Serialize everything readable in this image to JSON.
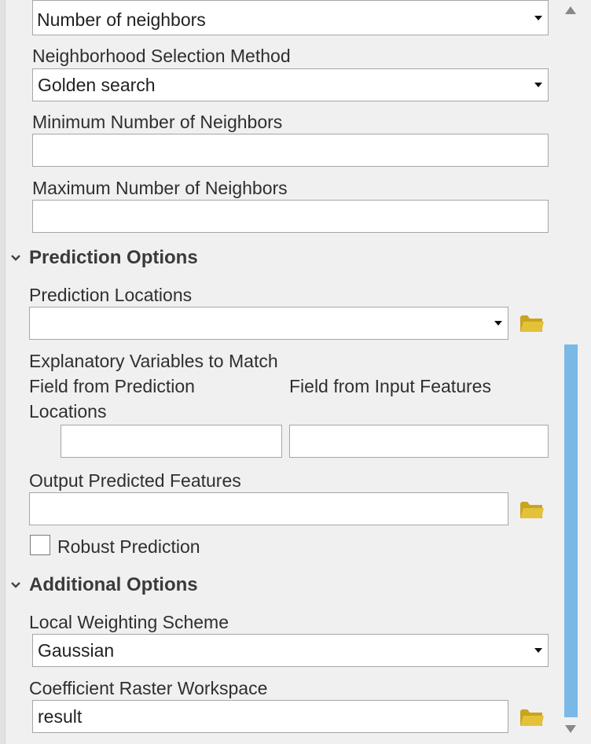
{
  "neighbors_section": {
    "type_value": "Number of neighbors",
    "selection_method_label": "Neighborhood Selection Method",
    "selection_method_value": "Golden search",
    "min_neighbors_label": "Minimum Number of Neighbors",
    "min_neighbors_value": "",
    "max_neighbors_label": "Maximum Number of Neighbors",
    "max_neighbors_value": ""
  },
  "prediction_options": {
    "title": "Prediction Options",
    "locations_label": "Prediction Locations",
    "locations_value": "",
    "explanatory_label": "Explanatory Variables to Match",
    "col_prediction_line1": "Field from Prediction",
    "col_prediction_line2": "Locations",
    "col_input": "Field from Input Features",
    "field_prediction_value": "",
    "field_input_value": "",
    "output_label": "Output Predicted Features",
    "output_value": "",
    "robust_label": "Robust Prediction",
    "robust_checked": false
  },
  "additional_options": {
    "title": "Additional Options",
    "weighting_label": "Local Weighting Scheme",
    "weighting_value": "Gaussian",
    "workspace_label": "Coefficient Raster Workspace",
    "workspace_value": "result"
  },
  "colors": {
    "folder_yellow": "#d8b62a",
    "scroll_thumb": "#7ab8e6"
  },
  "icons": {
    "folder": "folder-icon",
    "chevron": "chevron-down-icon",
    "dropdown": "dropdown-arrow-icon"
  }
}
